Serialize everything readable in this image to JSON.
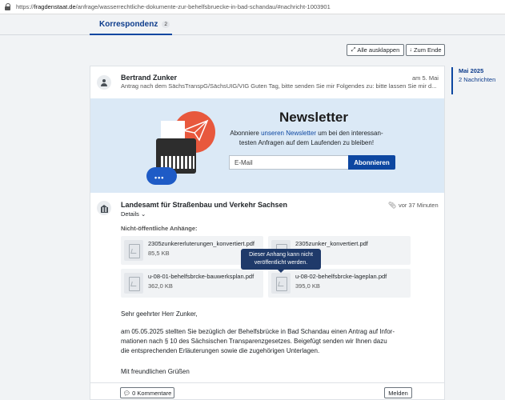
{
  "browser": {
    "url_prefix": "https://",
    "url_domain": "fragdenstaat.de",
    "url_path": "/anfrage/wasserrechtliche-dokumente-zur-behelfsbruecke-in-bad-schandau/#nachricht-1003901"
  },
  "tabs": [
    {
      "label": "Korrespondenz",
      "badge": "2"
    }
  ],
  "toolbar": {
    "expand_all": "Alle ausklappen",
    "expand_icon": "expand-arrows-icon",
    "to_end": "Zum Ende",
    "to_end_icon": "arrow-down-icon"
  },
  "messages": [
    {
      "sender": "Bertrand Zunker",
      "date": "am 5. Mai",
      "preview": "Antrag nach dem SächsTranspG/SächsUIG/VIG Guten Tag, bitte senden Sie mir Folgendes zu: bitte lassen Sie mir d..."
    },
    {
      "sender": "Landesamt für Straßenbau und Verkehr Sachsen",
      "date": "vor 37 Minuten",
      "details": "Details",
      "attachments_heading": "Nicht-öffentliche Anhänge:",
      "attachments": [
        {
          "name": "2305zunkererluterungen_konvertiert.pdf",
          "size": "85,5 KB"
        },
        {
          "name": "2305zunker_konvertiert.pdf",
          "size": ""
        },
        {
          "name": "u-08-01-behelfsbrcke-bauwerksplan.pdf",
          "size": "362,0 KB"
        },
        {
          "name": "u-08-02-behelfsbrcke-lageplan.pdf",
          "size": "395,0 KB"
        }
      ],
      "tooltip_line1": "Dieser Anhang kann nicht",
      "tooltip_line2": "veröffentlicht werden.",
      "greeting": "Sehr geehrter Herr Zunker,",
      "body_line1": "am 05.05.2025 stellten Sie bezüglich der Behelfsbrücke in Bad Schandau einen Antrag auf Infor-",
      "body_line2": "mationen nach § 10 des Sächsischen Transparenzgesetzes.  Beigefügt senden wir Ihnen dazu",
      "body_line3": "die entsprechenden Erläuterungen sowie die zugehörigen Unterlagen.",
      "closing": "Mit freundlichen Grüßen",
      "comments_button": "0 Kommentare",
      "report_button": "Melden"
    }
  ],
  "newsletter": {
    "title": "Newsletter",
    "text_before": "Abonniere ",
    "text_link": "unseren Newsletter",
    "text_after_line1": " um bei den interessan-",
    "text_line2": "testen Anfragen auf dem Laufenden zu bleiben!",
    "email_placeholder": "E-Mail",
    "subscribe_button": "Abonnieren"
  },
  "timeline": {
    "month": "Mai 2025",
    "count": "2 Nachrichten"
  },
  "colors": {
    "primary": "#0d47a1",
    "newsletter_bg": "#dbe9f6",
    "tooltip_bg": "#1f3a6a"
  }
}
